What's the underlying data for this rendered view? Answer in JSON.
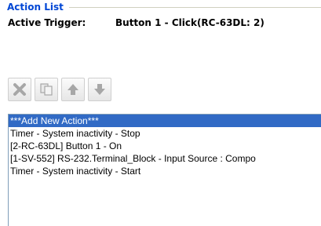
{
  "group": {
    "title": "Action List"
  },
  "trigger": {
    "label": "Active Trigger:",
    "value": "Button 1 - Click(RC-63DL: 2)"
  },
  "toolbar": {
    "buttons": [
      {
        "name": "delete-button",
        "icon": "delete-x-icon",
        "enabled": false
      },
      {
        "name": "copy-button",
        "icon": "copy-icon",
        "enabled": false
      },
      {
        "name": "move-up-button",
        "icon": "arrow-up-icon",
        "enabled": false
      },
      {
        "name": "move-down-button",
        "icon": "arrow-down-icon",
        "enabled": false
      }
    ]
  },
  "actions": {
    "items": [
      {
        "label": "***Add New Action***",
        "selected": true
      },
      {
        "label": "Timer - System inactivity - Stop",
        "selected": false
      },
      {
        "label": "[2-RC-63DL] Button 1 - On",
        "selected": false
      },
      {
        "label": "[1-SV-552] RS-232.Terminal_Block - Input Source : Compo",
        "selected": false
      },
      {
        "label": "Timer - System inactivity - Start",
        "selected": false
      }
    ]
  },
  "colors": {
    "title": "#0046d5",
    "selection": "#316ac5",
    "disabled_icon": "#a7a7a7"
  }
}
